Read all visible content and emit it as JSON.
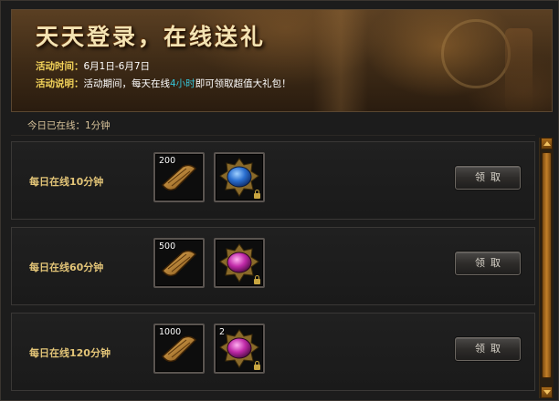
{
  "banner": {
    "title": "天天登录，在线送礼",
    "time_key": "活动时间：",
    "time_value": "6月1日-6月7日",
    "desc_key": "活动说明：",
    "desc_pre": "活动期间，每天在线",
    "desc_highlight": "4小时",
    "desc_post": "即可领取超值大礼包！"
  },
  "online_status": "今日已在线：1分钟",
  "rows": [
    {
      "label": "每日在线10分钟",
      "item1_qty": "200",
      "item2_qty": "",
      "item2_color": "blue",
      "button": "领取"
    },
    {
      "label": "每日在线60分钟",
      "item1_qty": "500",
      "item2_qty": "",
      "item2_color": "purple",
      "button": "领取"
    },
    {
      "label": "每日在线120分钟",
      "item1_qty": "1000",
      "item2_qty": "2",
      "item2_color": "purple",
      "button": "领取"
    }
  ],
  "colors": {
    "accent_gold": "#e2c477",
    "highlight_cyan": "#36c3d6",
    "scrollbar": "#c48028"
  },
  "icons": {
    "item1": "scroll-ticket-icon",
    "item2": "gem-brooch-icon",
    "lock": "lock-icon"
  }
}
